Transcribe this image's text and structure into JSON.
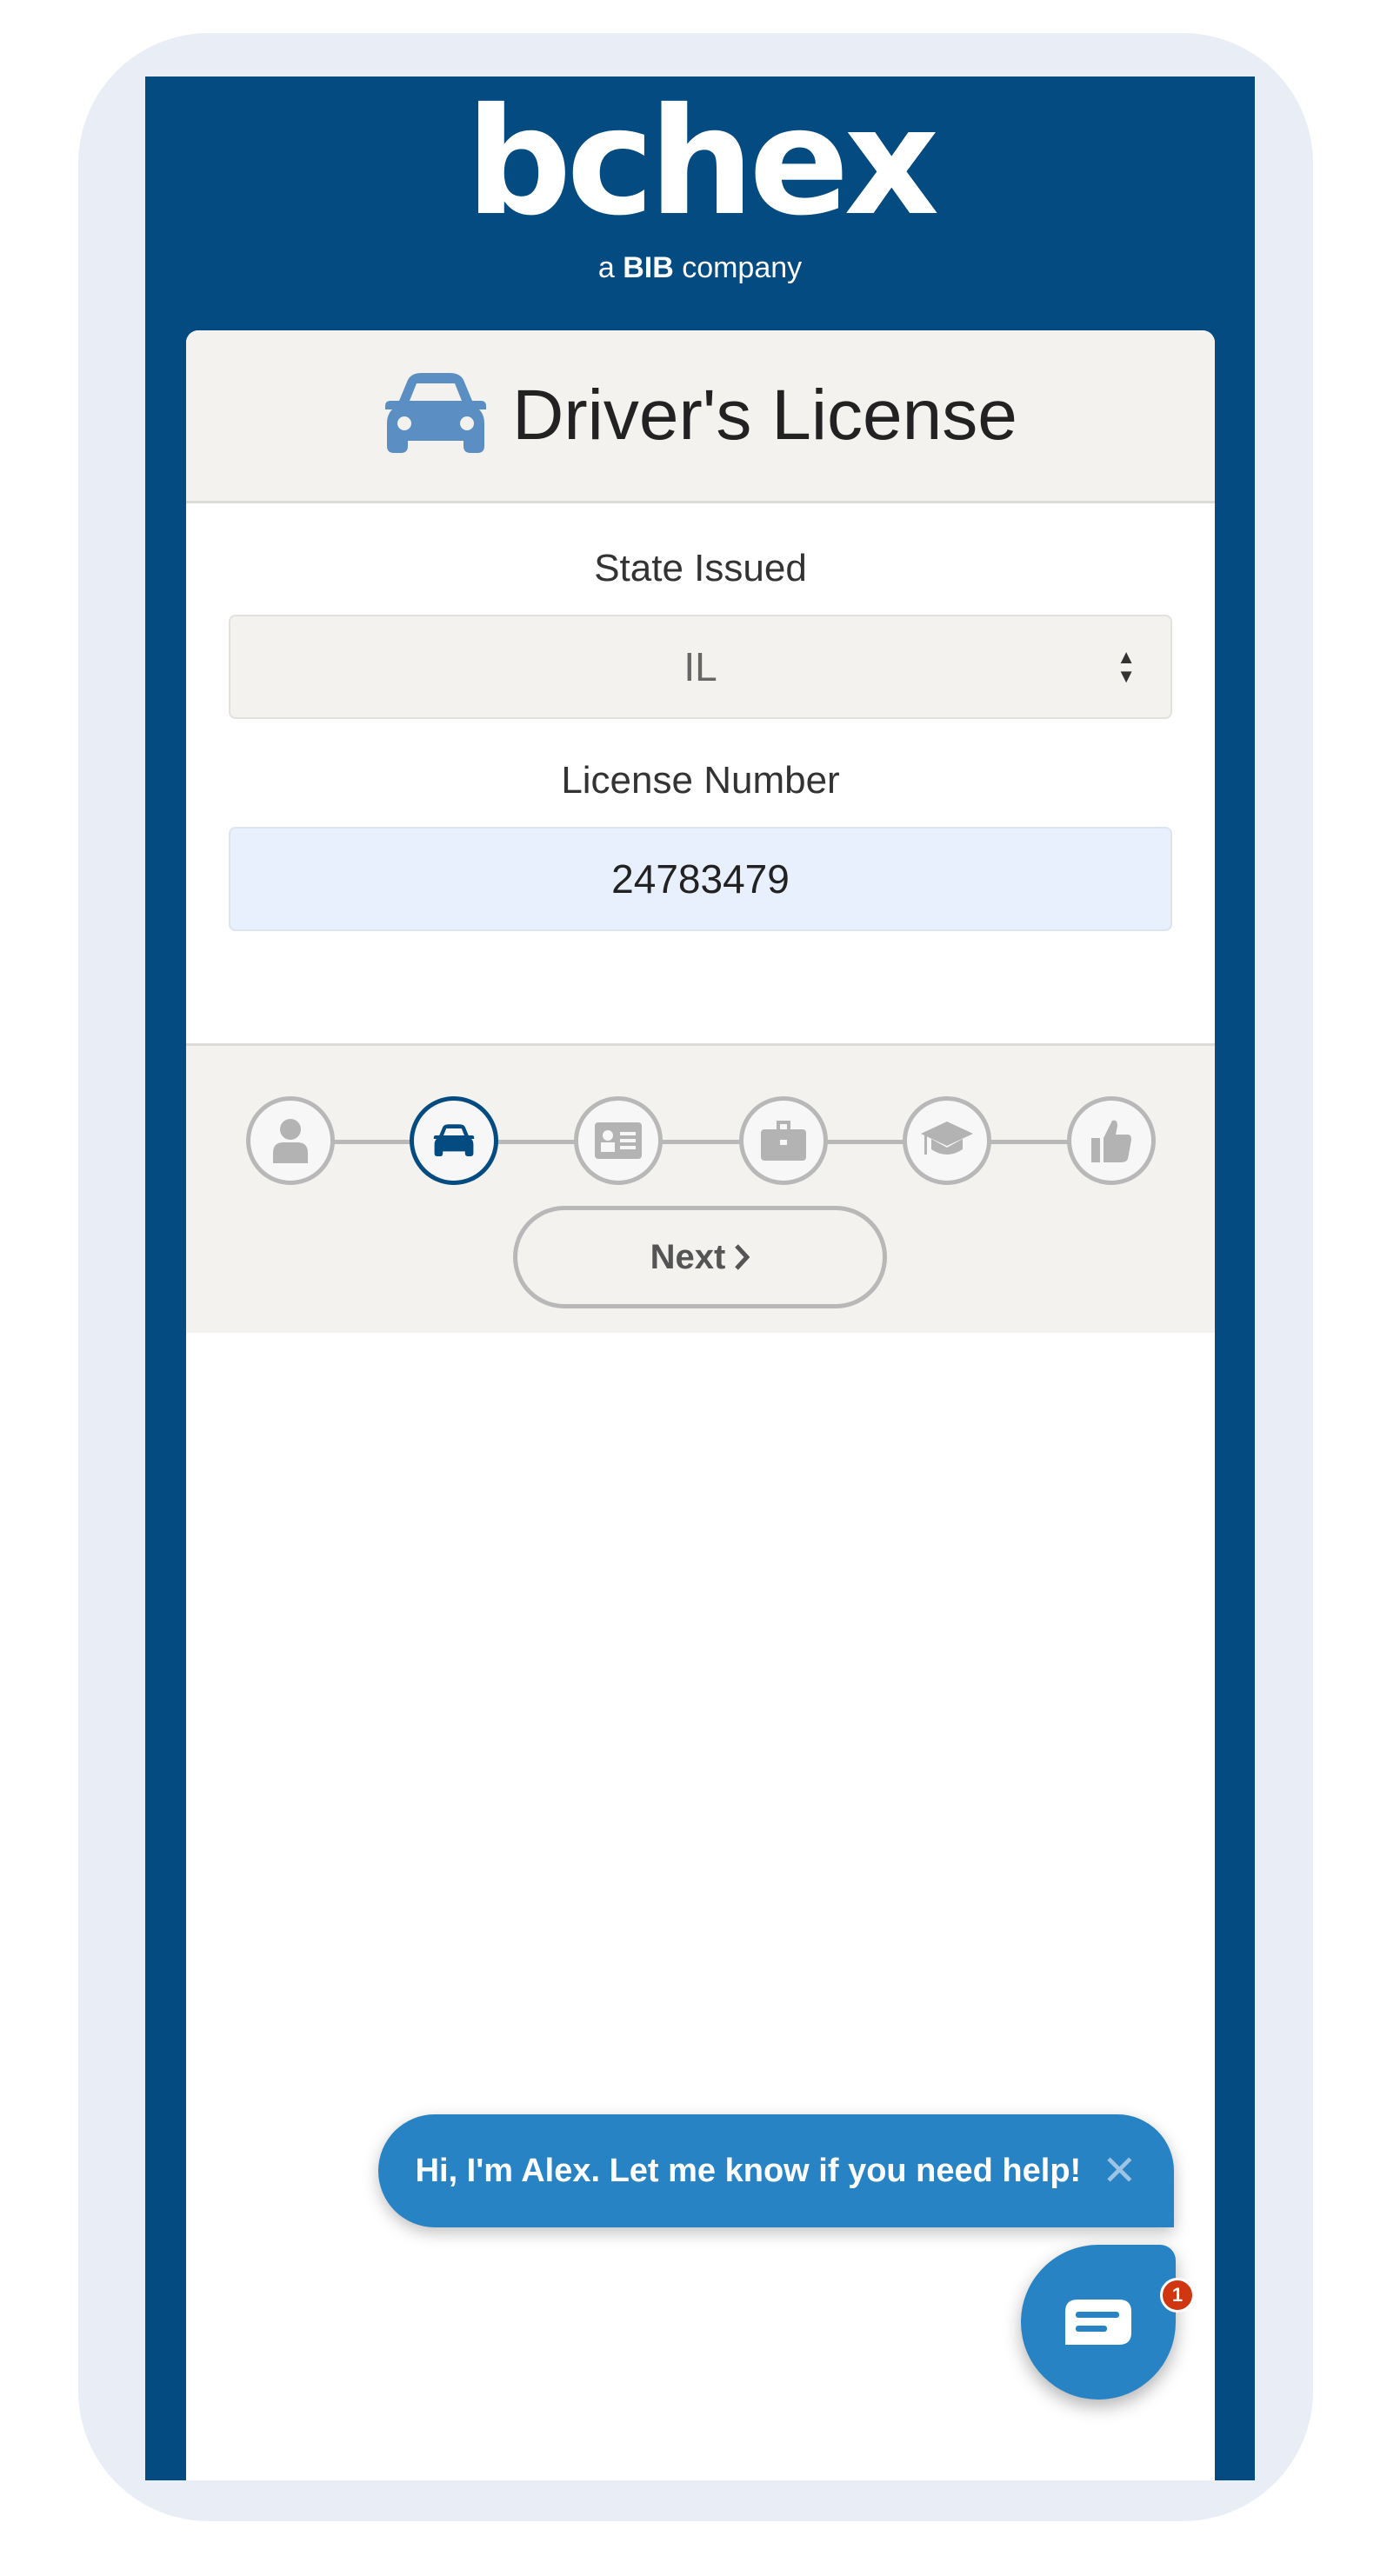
{
  "brand": {
    "logo_text": "bchex",
    "tagline_prefix": "a",
    "tagline_bold": "BIB",
    "tagline_suffix": "company"
  },
  "card": {
    "title": "Driver's License",
    "title_icon": "car-icon"
  },
  "form": {
    "state_label": "State Issued",
    "state_value": "IL",
    "license_label": "License Number",
    "license_value": "24783479"
  },
  "steps": [
    {
      "icon": "user-icon",
      "active": false
    },
    {
      "icon": "car-icon",
      "active": true
    },
    {
      "icon": "id-card-icon",
      "active": false
    },
    {
      "icon": "briefcase-icon",
      "active": false
    },
    {
      "icon": "graduation-cap-icon",
      "active": false
    },
    {
      "icon": "thumbs-up-icon",
      "active": false
    }
  ],
  "next_label": "Next",
  "chat": {
    "message": "Hi, I'm Alex. Let me know if you need help!",
    "badge_count": "1"
  },
  "colors": {
    "brand_blue": "#034b80",
    "chat_blue": "#2783c4",
    "badge_red": "#d0360f",
    "icon_blue": "#5b8fc4"
  }
}
